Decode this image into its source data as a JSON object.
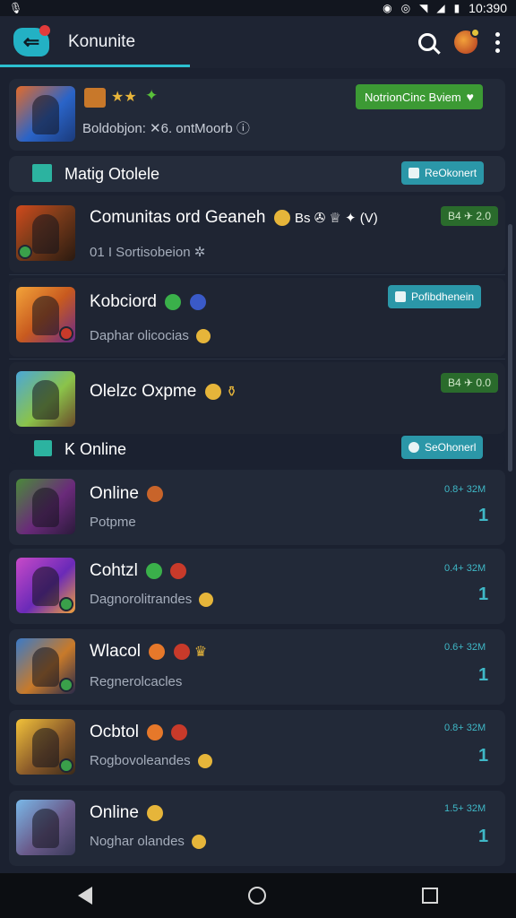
{
  "status_bar": {
    "time": "10:390",
    "left_icon": "mic-icon"
  },
  "app_bar": {
    "title": "Konunite",
    "logo_glyph": "⇐"
  },
  "featured": {
    "stars": "★★",
    "subtitle": "Boldobjon: ✕6. ontMoorb ⓘ",
    "button_label": "NotrionCinc Bviem"
  },
  "section_1": {
    "label": "Matig Otolele",
    "button_label": "ReOkonert"
  },
  "rows": [
    {
      "title": "Comunitas ord Geaneh",
      "title_suffix": "Bs  ✇ ♕ ✦ (V)",
      "sub": "01 I Sortisobeion ✲",
      "pill": "B4 ✈ 2.0",
      "pill_style": "dark-green"
    },
    {
      "title": "Kobciord",
      "sub": "Daphar olicocias",
      "pill": "Pofibdhenein",
      "pill_style": "teal"
    },
    {
      "title": "Olelzc Oxpme",
      "sub": "",
      "pill": "B4 ✈ 0.0",
      "pill_style": "dark-green"
    }
  ],
  "section_2": {
    "label": "K Online",
    "button_label": "SeOhonerl"
  },
  "online_rows": [
    {
      "title": "Online",
      "sub": "Potpme",
      "time": "0.8+ 32M",
      "count": "1"
    },
    {
      "title": "Cohtzl",
      "sub": "Dagnorolitrandes",
      "time": "0.4+ 32M",
      "count": "1"
    },
    {
      "title": "Wlacol",
      "sub": "Regnerolcacles",
      "time": "0.6+ 32M",
      "count": "1"
    },
    {
      "title": "Ocbtol",
      "sub": "Rogbovoleandes",
      "time": "0.8+ 32M",
      "count": "1"
    },
    {
      "title": "Online",
      "sub": "Noghar olandes",
      "time": "1.5+ 32M",
      "count": "1"
    }
  ],
  "colors": {
    "accent": "#2bc0d0",
    "green_button": "#3c9a34",
    "teal_button": "#2b97a8",
    "background": "#1b2130"
  }
}
